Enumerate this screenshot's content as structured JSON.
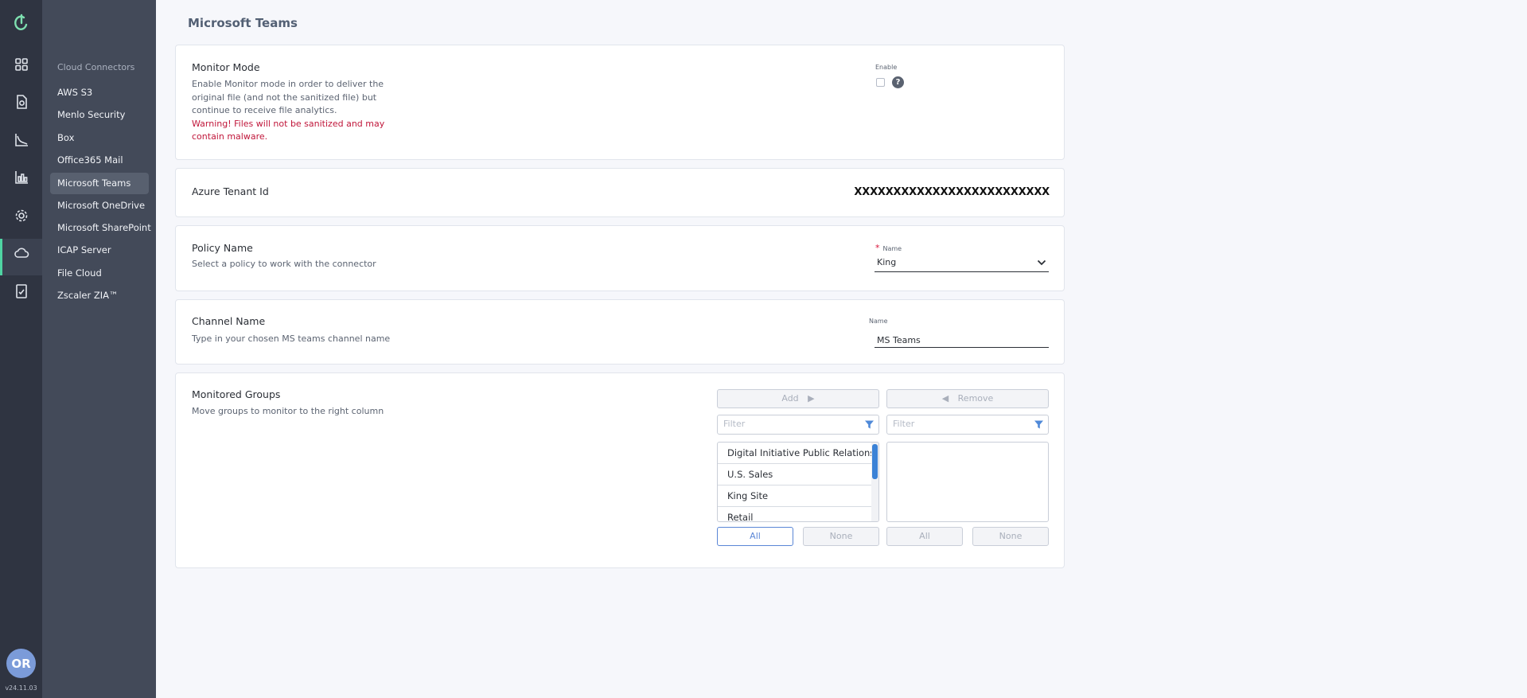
{
  "app": {
    "version": "v24.11.03",
    "user_initials": "OR",
    "accent_color": "#4fd4a2"
  },
  "rail": {
    "icons": [
      "app-logo-icon",
      "dashboard-icon",
      "scan-file-icon",
      "analytics-chart-icon",
      "reports-icon",
      "settings-gear-icon",
      "cloud-icon",
      "audit-log-icon"
    ],
    "active": "cloud-icon"
  },
  "nav": {
    "heading": "Cloud Connectors",
    "items": [
      {
        "label": "AWS S3"
      },
      {
        "label": "Menlo Security"
      },
      {
        "label": "Box"
      },
      {
        "label": "Office365 Mail"
      },
      {
        "label": "Microsoft Teams",
        "active": true
      },
      {
        "label": "Microsoft OneDrive"
      },
      {
        "label": "Microsoft SharePoint"
      },
      {
        "label": "ICAP Server"
      },
      {
        "label": "File Cloud"
      },
      {
        "label": "Zscaler ZIA™"
      }
    ]
  },
  "page": {
    "title": "Microsoft Teams"
  },
  "monitor_mode": {
    "title": "Monitor Mode",
    "desc_line1": "Enable Monitor mode in order to deliver the",
    "desc_line2": "original file (and not the sanitized file) but",
    "desc_line3": "continue to receive file analytics.",
    "warn_line1": "Warning! Files will not be sanitized and may",
    "warn_line2": "contain malware.",
    "enable_label": "Enable",
    "enabled": false,
    "help_glyph": "?"
  },
  "azure": {
    "title": "Azure Tenant Id",
    "value": "XXXXXXXXXXXXXXXXXXXXXXXXX"
  },
  "policy": {
    "title": "Policy Name",
    "desc": "Select a policy to work with the connector",
    "required_mark": "*",
    "field_label": "Name",
    "selected": "King"
  },
  "channel": {
    "title": "Channel Name",
    "desc": "Type in your chosen MS teams channel name",
    "field_label": "Name",
    "value": "MS Teams"
  },
  "groups": {
    "title": "Monitored Groups",
    "desc": "Move groups to monitor to the right column",
    "add_label": "Add",
    "remove_label": "Remove",
    "filter_placeholder": "Filter",
    "available": [
      "Digital Initiative Public Relations",
      "U.S. Sales",
      "King Site",
      "Retail"
    ],
    "selected": [],
    "all_label": "All",
    "none_label": "None"
  }
}
